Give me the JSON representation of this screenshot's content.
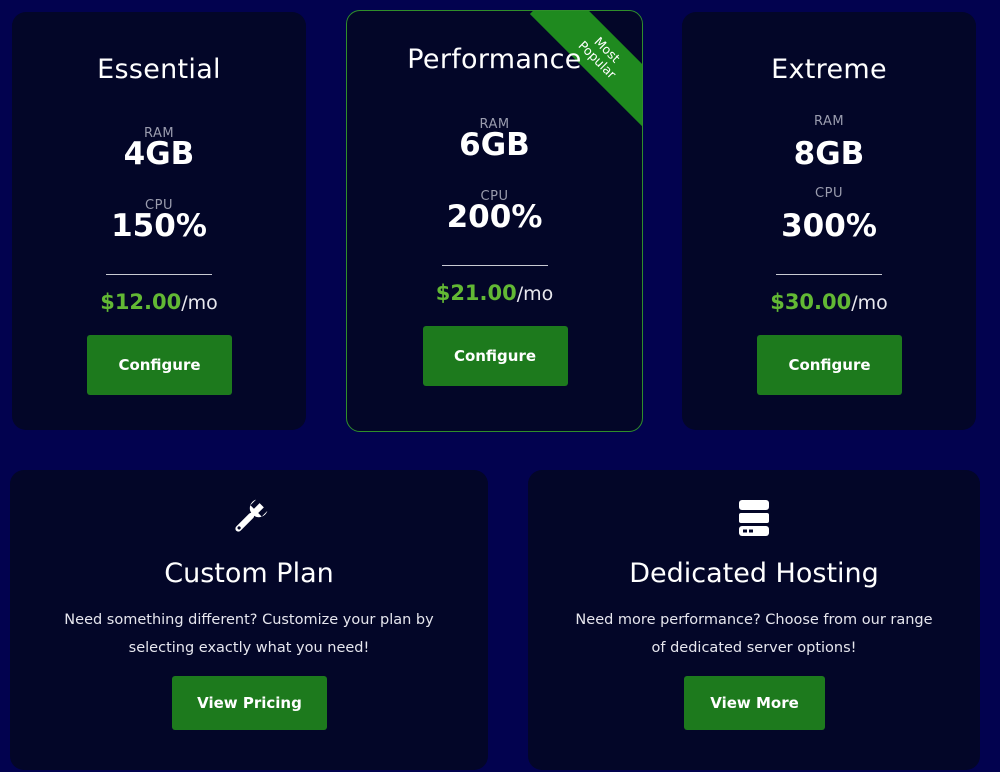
{
  "plans": [
    {
      "name": "Essential",
      "ram_label": "RAM",
      "ram_value": "4GB",
      "cpu_label": "CPU",
      "cpu_value": "150%",
      "price_amount": "$12.00",
      "price_period": "/mo",
      "button_label": "Configure"
    },
    {
      "name": "Performance",
      "ram_label": "RAM",
      "ram_value": "6GB",
      "cpu_label": "CPU",
      "cpu_value": "200%",
      "price_amount": "$21.00",
      "price_period": "/mo",
      "button_label": "Configure",
      "ribbon_line1": "Most",
      "ribbon_line2": "Popular"
    },
    {
      "name": "Extreme",
      "ram_label": "RAM",
      "ram_value": "8GB",
      "cpu_label": "CPU",
      "cpu_value": "300%",
      "price_amount": "$30.00",
      "price_period": "/mo",
      "button_label": "Configure"
    }
  ],
  "custom": {
    "icon": "wrench-icon",
    "title": "Custom Plan",
    "description": "Need something different? Customize your plan by selecting exactly what you need!",
    "button_label": "View Pricing"
  },
  "dedicated": {
    "icon": "server-icon",
    "title": "Dedicated Hosting",
    "description": "Need more performance? Choose from our range of dedicated server options!",
    "button_label": "View More"
  },
  "colors": {
    "background": "#02024f",
    "card": "#030628",
    "accent_green": "#1d7a1d",
    "price_green": "#62b834"
  }
}
